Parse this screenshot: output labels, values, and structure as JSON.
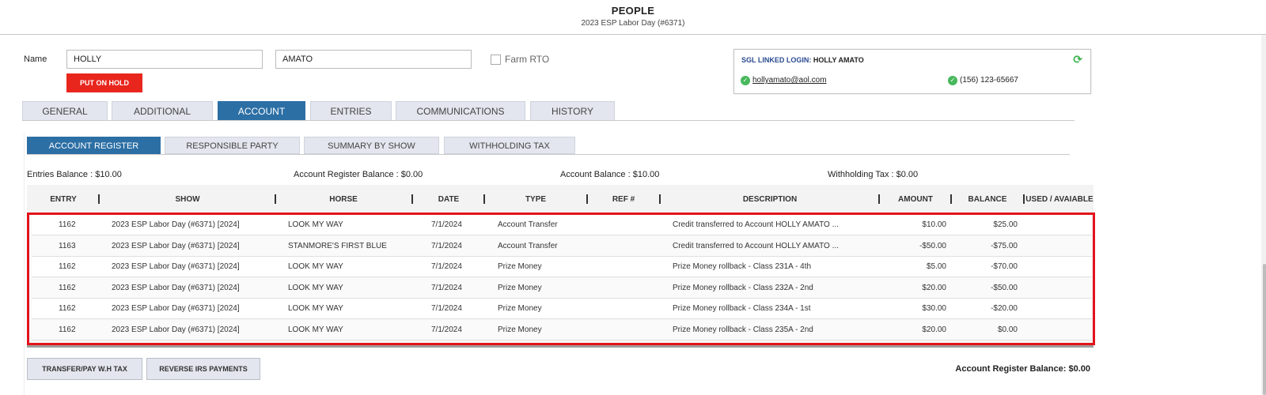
{
  "header": {
    "title": "PEOPLE",
    "subtitle": "2023 ESP Labor Day (#6371)"
  },
  "form": {
    "name_label": "Name",
    "first_name": "HOLLY",
    "last_name": "AMATO",
    "hold_button": "PUT ON HOLD",
    "farm_label": "Farm RTO"
  },
  "sgl": {
    "label": "SGL LINKED LOGIN:",
    "name": "HOLLY AMATO",
    "email": "hollyamato@aol.com",
    "phone": "(156) 123-65667",
    "refresh_icon": "refresh-icon",
    "check_icon": "check-circle-icon"
  },
  "tabs": [
    "GENERAL",
    "ADDITIONAL",
    "ACCOUNT",
    "ENTRIES",
    "COMMUNICATIONS",
    "HISTORY"
  ],
  "active_tab": "ACCOUNT",
  "subtabs": [
    "ACCOUNT REGISTER",
    "RESPONSIBLE PARTY",
    "SUMMARY BY SHOW",
    "WITHHOLDING TAX"
  ],
  "active_subtab": "ACCOUNT REGISTER",
  "summary": {
    "entries_balance": "Entries Balance : $10.00",
    "register_balance": "Account Register Balance : $0.00",
    "account_balance": "Account Balance : $10.00",
    "withholding_tax": "Withholding Tax : $0.00"
  },
  "table": {
    "columns": [
      "ENTRY",
      "SHOW",
      "HORSE",
      "DATE",
      "TYPE",
      "REF #",
      "DESCRIPTION",
      "AMOUNT",
      "BALANCE",
      "USED / AVAIABLE"
    ],
    "rows": [
      [
        "1162",
        "2023 ESP Labor Day (#6371) [2024]",
        "LOOK MY WAY",
        "7/1/2024",
        "Account Transfer",
        "",
        "Credit transferred to Account HOLLY AMATO ...",
        "$10.00",
        "$25.00",
        ""
      ],
      [
        "1163",
        "2023 ESP Labor Day (#6371) [2024]",
        "STANMORE'S FIRST BLUE",
        "7/1/2024",
        "Account Transfer",
        "",
        "Credit transferred to Account HOLLY AMATO ...",
        "-$50.00",
        "-$75.00",
        ""
      ],
      [
        "1162",
        "2023 ESP Labor Day (#6371) [2024]",
        "LOOK MY WAY",
        "7/1/2024",
        "Prize Money",
        "",
        "Prize Money rollback - Class 231A - 4th",
        "$5.00",
        "-$70.00",
        ""
      ],
      [
        "1162",
        "2023 ESP Labor Day (#6371) [2024]",
        "LOOK MY WAY",
        "7/1/2024",
        "Prize Money",
        "",
        "Prize Money rollback - Class 232A - 2nd",
        "$20.00",
        "-$50.00",
        ""
      ],
      [
        "1162",
        "2023 ESP Labor Day (#6371) [2024]",
        "LOOK MY WAY",
        "7/1/2024",
        "Prize Money",
        "",
        "Prize Money rollback - Class 234A - 1st",
        "$30.00",
        "-$20.00",
        ""
      ],
      [
        "1162",
        "2023 ESP Labor Day (#6371) [2024]",
        "LOOK MY WAY",
        "7/1/2024",
        "Prize Money",
        "",
        "Prize Money rollback - Class 235A - 2nd",
        "$20.00",
        "$0.00",
        ""
      ]
    ]
  },
  "bottom": {
    "transfer_button": "TRANSFER/PAY W.H TAX",
    "reverse_button": "REVERSE IRS PAYMENTS",
    "register_balance": "Account Register Balance: $0.00"
  },
  "colors": {
    "accent": "#2c6fa5",
    "hold": "#e8261d",
    "highlight": "#e3131b",
    "check": "#47b85c"
  }
}
